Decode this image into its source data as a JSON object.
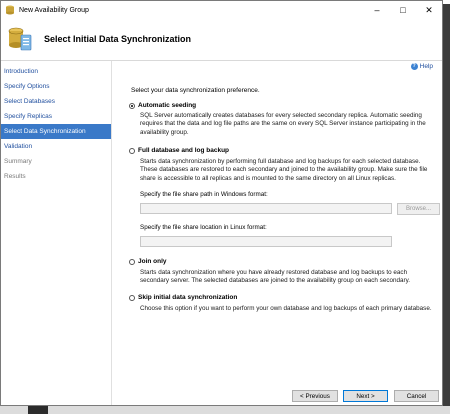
{
  "window": {
    "title": "New Availability Group"
  },
  "header": {
    "title": "Select Initial Data Synchronization"
  },
  "sidebar": {
    "items": [
      {
        "label": "Introduction"
      },
      {
        "label": "Specify Options"
      },
      {
        "label": "Select Databases"
      },
      {
        "label": "Specify Replicas"
      },
      {
        "label": "Select Data Synchronization"
      },
      {
        "label": "Validation"
      },
      {
        "label": "Summary"
      },
      {
        "label": "Results"
      }
    ]
  },
  "main": {
    "help_label": "Help",
    "prompt": "Select your data synchronization preference.",
    "options": [
      {
        "label": "Automatic seeding",
        "selected": true,
        "description": "SQL Server automatically creates databases for every selected secondary replica. Automatic seeding requires that the data and log file paths are the same on every SQL Server instance participating in the availability group."
      },
      {
        "label": "Full database and log backup",
        "selected": false,
        "description": "Starts data synchronization by performing full database and log backups for each selected database. These databases are restored to each secondary and joined to the availability group. Make sure the file share is accessible to all replicas and is mounted to the same directory on all Linux replicas."
      },
      {
        "label": "Join only",
        "selected": false,
        "description": "Starts data synchronization where you have already restored database and log backups to each secondary server. The selected databases are joined to the availability group on each secondary."
      },
      {
        "label": "Skip initial data synchronization",
        "selected": false,
        "description": "Choose this option if you want to perform your own database and log backups of each primary database."
      }
    ],
    "windows_path_label": "Specify the file share path in Windows format:",
    "windows_path_value": "",
    "linux_path_label": "Specify the file share location in Linux format:",
    "linux_path_value": "",
    "browse_label": "Browse..."
  },
  "footer": {
    "previous_label": "< Previous",
    "next_label": "Next >",
    "cancel_label": "Cancel"
  }
}
